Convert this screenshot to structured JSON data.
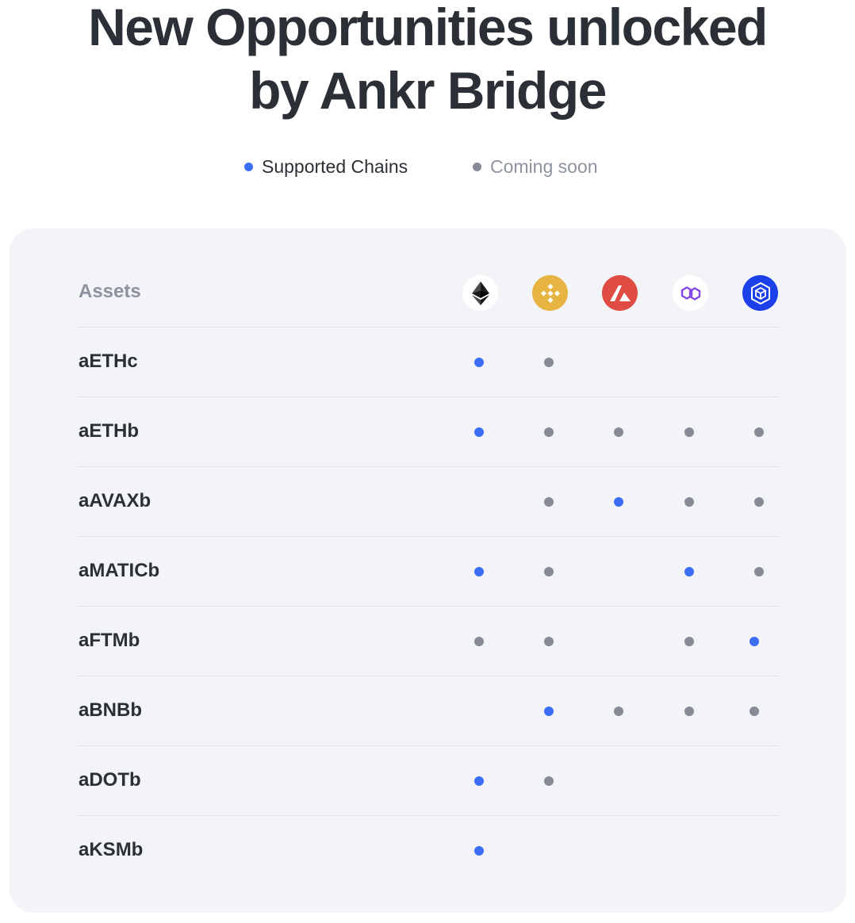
{
  "page": {
    "title_line1": "New Opportunities unlocked",
    "title_line2": "by Ankr Bridge"
  },
  "legend": {
    "supported": {
      "label": "Supported Chains",
      "color": "#3b6ef3"
    },
    "coming_soon": {
      "label": "Coming soon",
      "color": "#868b97"
    }
  },
  "table": {
    "assets_header": "Assets",
    "chains": [
      {
        "key": "eth",
        "icon": "ethereum-icon",
        "bg": "#ffffff"
      },
      {
        "key": "bnb",
        "icon": "binance-icon",
        "bg": "#e8b441"
      },
      {
        "key": "avax",
        "icon": "avalanche-icon",
        "bg": "#df4c43"
      },
      {
        "key": "matic",
        "icon": "polygon-icon",
        "bg": "#ffffff"
      },
      {
        "key": "ftm",
        "icon": "fantom-icon",
        "bg": "#1b3fe8"
      }
    ],
    "rows": [
      {
        "asset": "aETHc",
        "status": [
          "supported",
          "soon",
          "",
          "",
          ""
        ]
      },
      {
        "asset": "aETHb",
        "status": [
          "supported",
          "soon",
          "soon",
          "soon",
          "soon"
        ]
      },
      {
        "asset": "aAVAXb",
        "status": [
          "",
          "soon",
          "supported",
          "soon",
          "soon"
        ]
      },
      {
        "asset": "aMATICb",
        "status": [
          "supported",
          "soon",
          "",
          "supported",
          "soon"
        ]
      },
      {
        "asset": "aFTMb",
        "status": [
          "soon",
          "soon",
          "",
          "soon",
          "supported"
        ]
      },
      {
        "asset": "aBNBb",
        "status": [
          "",
          "supported",
          "soon",
          "soon",
          "soon"
        ]
      },
      {
        "asset": "aDOTb",
        "status": [
          "supported",
          "soon",
          "",
          "",
          ""
        ]
      },
      {
        "asset": "aKSMb",
        "status": [
          "supported",
          "",
          "",
          "",
          ""
        ]
      }
    ]
  }
}
